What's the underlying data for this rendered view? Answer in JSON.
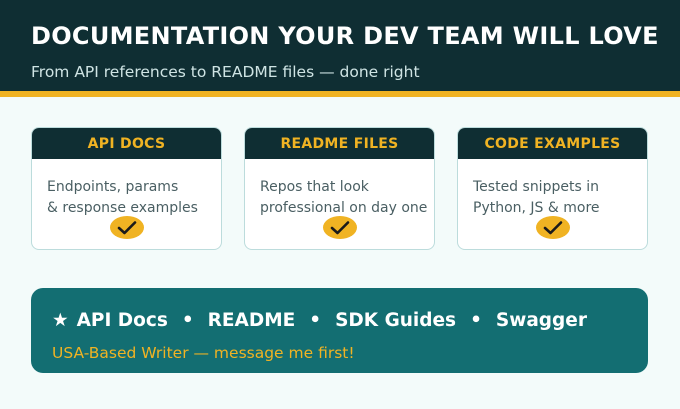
{
  "header": {
    "headline": "DOCUMENTATION YOUR DEV TEAM WILL LOVE",
    "subline": "From API references to README files — done right"
  },
  "cards": [
    {
      "title": "API DOCS",
      "lines": [
        "Endpoints, params",
        "& response examples"
      ],
      "icon": "check-icon"
    },
    {
      "title": "README FILES",
      "lines": [
        "Repos that look",
        "professional on day one"
      ],
      "icon": "check-icon"
    },
    {
      "title": "CODE EXAMPLES",
      "lines": [
        "Tested snippets in",
        "Python, JS & more"
      ],
      "icon": "check-icon"
    }
  ],
  "banner": {
    "star": "★",
    "items": [
      "API Docs",
      "README",
      "SDK Guides",
      "Swagger"
    ],
    "separator": "•",
    "cta": "USA-Based Writer — message me first!"
  },
  "colors": {
    "navy": "#0f2e33",
    "accent_gold": "#f0b323",
    "teal": "#136e72",
    "page_background": "#f3fbfa"
  }
}
